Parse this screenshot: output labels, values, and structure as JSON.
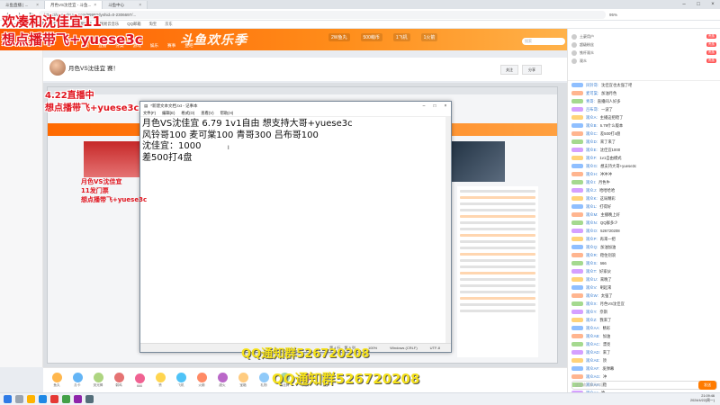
{
  "browser": {
    "tabs": [
      {
        "label": "斗鱼直播 | ..."
      },
      {
        "label": "月色VS沈佳宜 - 斗鱼..."
      },
      {
        "label": "斗鱼中心"
      }
    ],
    "url": "https://www.douyu.com/9999?dyshid=0-2306697/...",
    "zoom": "95%",
    "bookmarks": [
      "百度一下",
      "斗鱼直播",
      "虎牙直播",
      "哔哩哔哩",
      "网易云音乐",
      "QQ邮箱",
      "淘宝",
      "京东"
    ]
  },
  "site": {
    "nav": [
      "首页",
      "直播",
      "分类",
      "游戏",
      "娱乐",
      "赛事",
      "鱼吧"
    ],
    "banner_text": "斗鱼欢乐季",
    "banner_tags": [
      "2W鱼丸",
      "500萌币",
      "1飞机",
      "1火箭"
    ],
    "search_placeholder": "搜索"
  },
  "room": {
    "title": "月色VS沈佳宜 赛！",
    "follow_label": "关注",
    "share_label": "分享"
  },
  "notepad": {
    "title": "*新建文本文档.txt - 记事本",
    "menu": [
      "文件(F)",
      "编辑(E)",
      "格式(O)",
      "查看(V)",
      "帮助(H)"
    ],
    "lines": [
      "月色VS沈佳宜 6.79 1v1自由  想支持大哥+yuese3c",
      "风铃哥100 麦可棠100 青哥300 吕布哥100",
      "沈佳宜：1000",
      "差500打4盘"
    ],
    "status": [
      "第 4 行，第 5 列",
      "100%",
      "Windows (CRLF)",
      "UTF-8"
    ]
  },
  "overlays": {
    "top_red_1": "欢凑和沈佳宜11",
    "top_red_2": "想点播带飞+yuese3c",
    "nested_red_1": "4.22直播中",
    "nested_red_2": "想点播带飞+yuese3c",
    "nested_red_3": "月色VS沈佳宜",
    "nested_red_4": "11发门票",
    "nested_red_5": "想点播带飞+yuese3c",
    "qq_1": "QQ通知群526720208",
    "qq_2": "QQ通知群526720208"
  },
  "chat": {
    "ranks": [
      {
        "name": "土豪用户",
        "badge": "贵族"
      },
      {
        "name": "超级粉丝",
        "badge": "贵族"
      },
      {
        "name": "铁杆观众",
        "badge": "贵族"
      },
      {
        "name": "观众",
        "badge": "贵族"
      }
    ],
    "messages": [
      {
        "nick": "风铃哥:",
        "text": "沈佳宜也太强了吧"
      },
      {
        "nick": "麦可棠:",
        "text": "加油月色"
      },
      {
        "nick": "青哥:",
        "text": "直播间人好多"
      },
      {
        "nick": "吕布哥:",
        "text": "一波了"
      },
      {
        "nick": "观众A:",
        "text": "主播这把稳了"
      },
      {
        "nick": "观众B:",
        "text": "6.79什么版本"
      },
      {
        "nick": "观众C:",
        "text": "差500打4盘"
      },
      {
        "nick": "观众D:",
        "text": "来了来了"
      },
      {
        "nick": "观众E:",
        "text": "沈佳宜1000"
      },
      {
        "nick": "观众F:",
        "text": "1v1自由模式"
      },
      {
        "nick": "观众G:",
        "text": "想支持大哥+yuese3c"
      },
      {
        "nick": "观众H:",
        "text": "冲冲冲"
      },
      {
        "nick": "观众I:",
        "text": "月色牛"
      },
      {
        "nick": "观众J:",
        "text": "哈哈哈哈"
      },
      {
        "nick": "观众K:",
        "text": "这局精彩"
      },
      {
        "nick": "观众L:",
        "text": "打得好"
      },
      {
        "nick": "观众M:",
        "text": "主播晚上好"
      },
      {
        "nick": "观众N:",
        "text": "QQ群多少"
      },
      {
        "nick": "观众O:",
        "text": "526720208"
      },
      {
        "nick": "观众P:",
        "text": "再来一把"
      },
      {
        "nick": "观众Q:",
        "text": "加油加油"
      },
      {
        "nick": "观众R:",
        "text": "稳住别浪"
      },
      {
        "nick": "观众S:",
        "text": "666"
      },
      {
        "nick": "观众T:",
        "text": "好家伙"
      },
      {
        "nick": "观众U:",
        "text": "来晚了"
      },
      {
        "nick": "观众V:",
        "text": "刷起来"
      },
      {
        "nick": "观众W:",
        "text": "太强了"
      },
      {
        "nick": "观众X:",
        "text": "月色VS沈佳宜"
      },
      {
        "nick": "观众Y:",
        "text": "奈斯"
      },
      {
        "nick": "观众Z:",
        "text": "我来了"
      },
      {
        "nick": "观众AA:",
        "text": "精彩"
      },
      {
        "nick": "观众AB:",
        "text": "加油"
      },
      {
        "nick": "观众AC:",
        "text": "漂亮"
      },
      {
        "nick": "观众AD:",
        "text": "来了"
      },
      {
        "nick": "观众AE:",
        "text": "顶"
      },
      {
        "nick": "观众AF:",
        "text": "发弹幕"
      },
      {
        "nick": "观众AG:",
        "text": "冲"
      },
      {
        "nick": "观众AH:",
        "text": "稳"
      },
      {
        "nick": "观众AI:",
        "text": "哈"
      }
    ],
    "input_placeholder": "这里输入聊天内容",
    "send_label": "发送"
  },
  "gifts": [
    "鱼丸",
    "办卡",
    "荧光棒",
    "弱鸡",
    "666",
    "赞",
    "飞机",
    "火箭",
    "超火",
    "宝箱",
    "礼物",
    "粉丝牌",
    "贵族",
    "更多"
  ],
  "taskbar": {
    "time": "21:09:46",
    "date": "2024/4/22(周一)"
  },
  "colors": {
    "accent": "#ff7b00",
    "overlay_red": "#e0141e",
    "overlay_yellow": "#f5e11a"
  }
}
